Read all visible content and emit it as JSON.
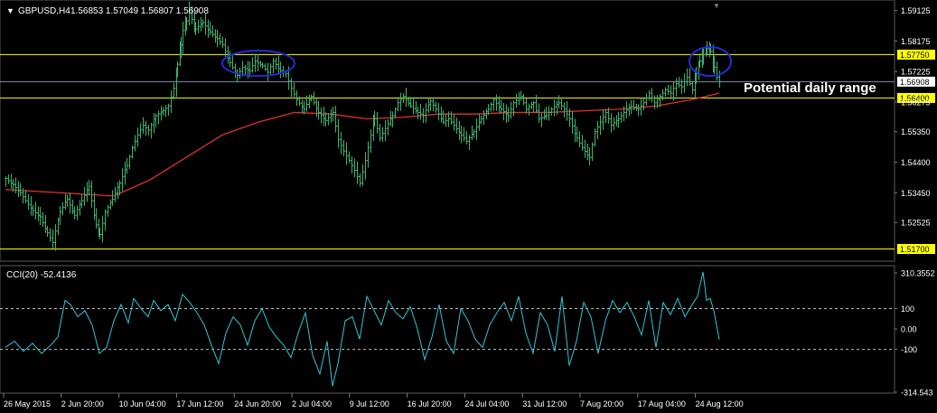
{
  "header": {
    "symbol_label": "GBPUSD,H4",
    "ohlc_label": "1.56853 1.57049 1.56807 1.56908"
  },
  "annotation": {
    "text": "Potential daily range"
  },
  "colors": {
    "background": "#000000",
    "bars": "#3cb371",
    "moving_average": "#e03030",
    "support_resistance": "#ffff00",
    "current_price_line": "#8a8fb0",
    "highlight_ellipse": "#1f2dd6",
    "cci_line": "#2fc6d6",
    "axis_text": "#ffffff",
    "price_tag_fill": "#ffff00",
    "price_tag_text": "#000000"
  },
  "chart_data": [
    {
      "type": "line",
      "title": "",
      "panel": "price",
      "x_tick_labels": [
        "26 May 2015",
        "2 Jun 20:00",
        "10 Jun 04:00",
        "17 Jun 12:00",
        "24 Jun 20:00",
        "2 Jul 04:00",
        "9 Jul 12:00",
        "16 Jul 20:00",
        "24 Jul 04:00",
        "31 Jul 12:00",
        "7 Aug 20:00",
        "17 Aug 04:00",
        "24 Aug 12:00"
      ],
      "y_tick_labels": [
        "1.59125",
        "1.58175",
        "1.57225",
        "1.56275",
        "1.55350",
        "1.54400",
        "1.53450",
        "1.52525"
      ],
      "ylim": [
        1.5132,
        1.5945
      ],
      "grid": false,
      "horizontal_lines": [
        {
          "label": "1.57750",
          "value": 1.5775,
          "style": "yellow"
        },
        {
          "label": "1.56908",
          "value": 1.56908,
          "style": "current-price"
        },
        {
          "label": "1.56400",
          "value": 1.564,
          "style": "yellow"
        },
        {
          "label": "1.51700",
          "value": 1.517,
          "style": "yellow"
        }
      ],
      "series": [
        {
          "x": [
            0,
            8,
            16,
            22,
            30,
            38,
            46,
            52,
            60,
            68,
            76,
            84,
            92,
            100,
            104,
            110,
            118,
            126,
            134,
            140,
            146,
            152,
            158,
            166,
            174,
            180,
            186,
            190,
            194,
            196,
            200,
            203,
            206,
            210,
            218,
            226,
            234,
            240,
            248,
            256,
            262,
            270,
            276,
            284,
            290,
            296,
            304,
            310,
            316,
            322,
            330,
            338,
            346,
            354,
            362,
            368,
            374,
            380,
            386,
            392,
            398,
            404,
            408,
            414,
            420,
            428,
            434,
            440,
            448,
            456,
            462,
            470,
            476,
            484,
            490,
            496,
            504,
            510,
            518,
            526,
            534,
            540,
            548,
            556,
            562,
            570,
            576,
            584,
            590,
            598,
            604,
            612,
            618,
            624,
            632,
            638,
            646,
            652,
            658,
            664,
            670,
            678,
            684,
            692,
            700,
            706,
            712,
            718,
            724,
            730,
            736,
            742,
            748,
            754,
            760,
            764,
            768,
            772,
            776,
            780,
            784,
            787,
            790
          ],
          "y": [
            1.539,
            1.537,
            1.5345,
            1.532,
            1.529,
            1.527,
            1.522,
            1.519,
            1.5285,
            1.5325,
            1.5275,
            1.532,
            1.5365,
            1.5245,
            1.5215,
            1.5285,
            1.5325,
            1.5375,
            1.543,
            1.5485,
            1.5525,
            1.5555,
            1.554,
            1.5585,
            1.56,
            1.5615,
            1.567,
            1.5745,
            1.5805,
            1.585,
            1.588,
            1.5915,
            1.5885,
            1.5855,
            1.5875,
            1.5845,
            1.5825,
            1.5805,
            1.575,
            1.571,
            1.5735,
            1.5725,
            1.5755,
            1.574,
            1.572,
            1.5755,
            1.5725,
            1.5715,
            1.567,
            1.5635,
            1.5605,
            1.5645,
            1.5595,
            1.557,
            1.5595,
            1.551,
            1.5475,
            1.5445,
            1.5415,
            1.5375,
            1.5445,
            1.5525,
            1.5575,
            1.5515,
            1.5545,
            1.5585,
            1.5625,
            1.5645,
            1.5615,
            1.5595,
            1.5585,
            1.563,
            1.5605,
            1.5565,
            1.5575,
            1.5555,
            1.5525,
            1.5505,
            1.5535,
            1.5575,
            1.5605,
            1.5635,
            1.5605,
            1.5585,
            1.5625,
            1.5645,
            1.5605,
            1.5625,
            1.5575,
            1.5585,
            1.5605,
            1.5625,
            1.5605,
            1.5575,
            1.5515,
            1.5485,
            1.5455,
            1.5535,
            1.5565,
            1.5595,
            1.5555,
            1.5575,
            1.5595,
            1.5615,
            1.5605,
            1.5625,
            1.5655,
            1.5625,
            1.5645,
            1.5665,
            1.5655,
            1.5685,
            1.5675,
            1.5705,
            1.5665,
            1.5715,
            1.5755,
            1.5775,
            1.5795,
            1.5785,
            1.5735,
            1.5705,
            1.5691
          ]
        },
        {
          "name": "",
          "x": [
            0,
            60,
            120,
            160,
            200,
            240,
            280,
            320,
            360,
            400,
            440,
            480,
            520,
            560,
            600,
            640,
            680,
            720,
            760,
            790
          ],
          "y": [
            1.5355,
            1.5345,
            1.5335,
            1.5385,
            1.5455,
            1.5525,
            1.5565,
            1.5595,
            1.559,
            1.5575,
            1.558,
            1.559,
            1.559,
            1.5595,
            1.5595,
            1.56,
            1.5605,
            1.5615,
            1.5635,
            1.5655
          ]
        }
      ]
    },
    {
      "type": "line",
      "title": "",
      "panel": "oscillator",
      "label": "CCI(20) -52.4136",
      "y_tick_labels": [
        "310.3552",
        "100",
        "0.00",
        "-100",
        "-314.543"
      ],
      "ylim": [
        -314.543,
        310.3552
      ],
      "grid": false,
      "reference_levels": [
        100,
        -100
      ],
      "series": [
        {
          "name": "",
          "x": [
            0,
            10,
            20,
            30,
            40,
            50,
            58,
            66,
            72,
            80,
            88,
            96,
            104,
            112,
            120,
            128,
            136,
            142,
            150,
            158,
            164,
            172,
            180,
            188,
            196,
            204,
            212,
            220,
            228,
            236,
            244,
            252,
            260,
            268,
            276,
            284,
            292,
            300,
            308,
            316,
            324,
            332,
            340,
            348,
            356,
            362,
            368,
            376,
            384,
            392,
            400,
            408,
            416,
            424,
            432,
            440,
            448,
            456,
            464,
            472,
            480,
            488,
            496,
            504,
            512,
            520,
            528,
            536,
            544,
            552,
            560,
            568,
            576,
            584,
            592,
            600,
            608,
            616,
            624,
            632,
            640,
            648,
            656,
            664,
            672,
            680,
            688,
            696,
            704,
            712,
            720,
            728,
            736,
            744,
            752,
            760,
            766,
            772,
            776,
            780,
            784,
            790
          ],
          "y": [
            -90,
            -60,
            -110,
            -70,
            -120,
            -80,
            -40,
            140,
            120,
            60,
            90,
            20,
            -120,
            -90,
            40,
            120,
            30,
            150,
            100,
            60,
            140,
            90,
            120,
            40,
            170,
            130,
            80,
            20,
            -80,
            -170,
            -20,
            60,
            20,
            -80,
            40,
            100,
            10,
            -40,
            -80,
            -140,
            -20,
            80,
            -130,
            -220,
            -60,
            -280,
            -170,
            40,
            60,
            -50,
            160,
            90,
            20,
            140,
            80,
            50,
            110,
            0,
            -150,
            -40,
            120,
            -60,
            -120,
            100,
            40,
            -50,
            -90,
            20,
            80,
            130,
            40,
            160,
            -20,
            -120,
            80,
            20,
            -110,
            160,
            -180,
            -60,
            130,
            60,
            -120,
            40,
            140,
            80,
            130,
            60,
            -30,
            140,
            -90,
            130,
            70,
            150,
            60,
            120,
            160,
            280,
            140,
            150,
            90,
            -52
          ]
        }
      ]
    }
  ]
}
